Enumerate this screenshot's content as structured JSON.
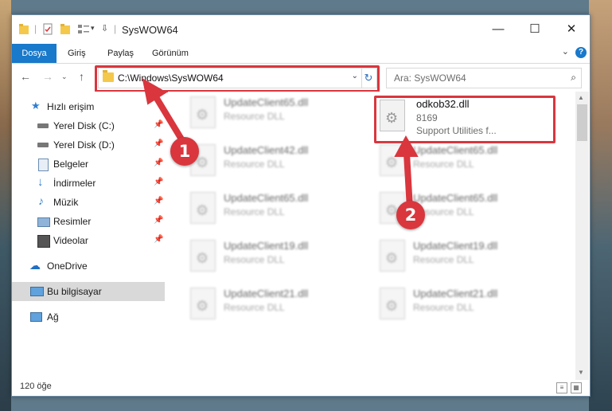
{
  "window": {
    "title": "SysWOW64"
  },
  "ribbon": {
    "tabs": [
      "Dosya",
      "Giriş",
      "Paylaş",
      "Görünüm"
    ],
    "help": "?"
  },
  "address": {
    "path": "C:\\Windows\\SysWOW64"
  },
  "search": {
    "placeholder": "Ara: SysWOW64"
  },
  "sidebar": {
    "items": [
      {
        "label": "Hızlı erişim"
      },
      {
        "label": "Yerel Disk (C:)"
      },
      {
        "label": "Yerel Disk (D:)"
      },
      {
        "label": "Belgeler"
      },
      {
        "label": "İndirmeler"
      },
      {
        "label": "Müzik"
      },
      {
        "label": "Resimler"
      },
      {
        "label": "Videolar"
      },
      {
        "label": "OneDrive"
      },
      {
        "label": "Bu bilgisayar"
      },
      {
        "label": "Ağ"
      }
    ]
  },
  "files": {
    "highlighted": {
      "name": "odkob32.dll",
      "size": "8169",
      "desc": "Support Utilities f..."
    },
    "left": [
      {
        "name": "UpdateClient65.dll",
        "type": "Resource DLL"
      },
      {
        "name": "UpdateClient42.dll",
        "type": "Resource DLL"
      },
      {
        "name": "UpdateClient65.dll",
        "type": "Resource DLL"
      },
      {
        "name": "UpdateClient19.dll",
        "type": "Resource DLL"
      },
      {
        "name": "UpdateClient21.dll",
        "type": "Resource DLL"
      }
    ],
    "right": [
      {
        "name": "UpdateClient65.dll",
        "type": "Resource DLL"
      },
      {
        "name": "UpdateClient65.dll",
        "type": "Resource DLL"
      },
      {
        "name": "UpdateClient19.dll",
        "type": "Resource DLL"
      },
      {
        "name": "UpdateClient21.dll",
        "type": "Resource DLL"
      }
    ]
  },
  "status": {
    "count": "120 öğe"
  },
  "callouts": {
    "one": "1",
    "two": "2"
  },
  "colors": {
    "accent": "#1979ca",
    "highlight": "#d9363e"
  }
}
